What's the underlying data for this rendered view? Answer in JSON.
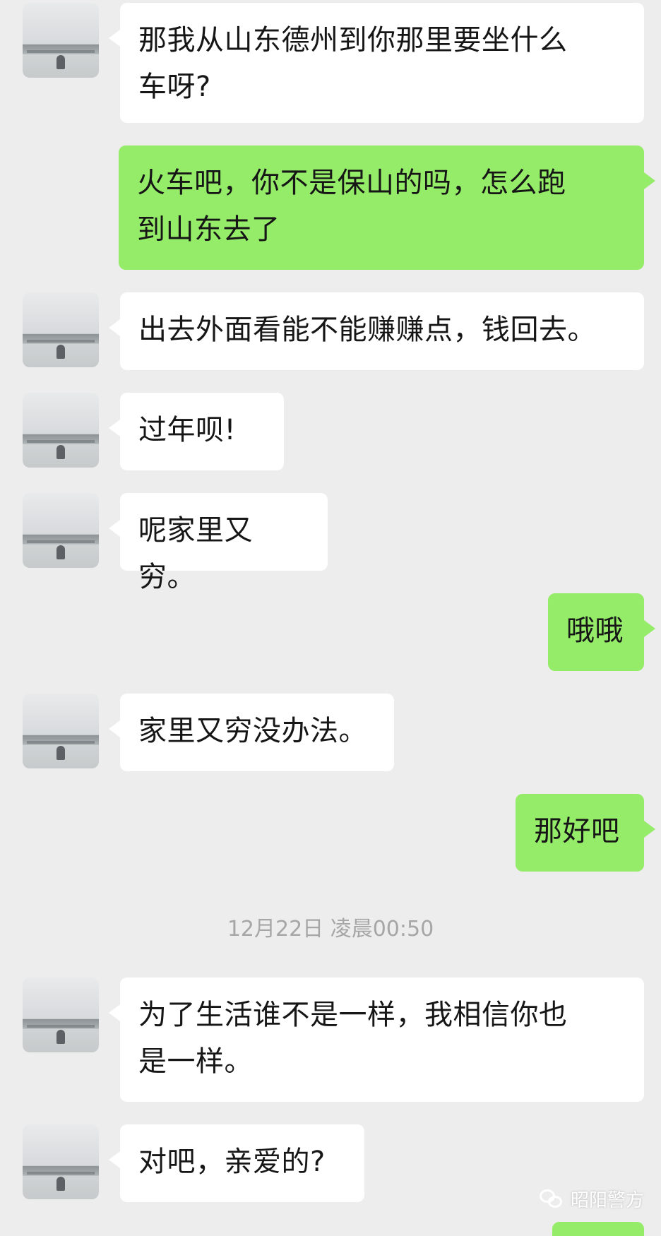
{
  "messages": [
    {
      "from": "contact",
      "text_lines": [
        "那我从山东德州到你那里要坐什么",
        "车呀?"
      ]
    },
    {
      "from": "me",
      "text_lines": [
        "火车吧，你不是保山的吗，怎么跑",
        "到山东去了"
      ]
    },
    {
      "from": "contact",
      "text_lines": [
        "出去外面看能不能赚赚点，钱回去。"
      ]
    },
    {
      "from": "contact",
      "text_lines": [
        "过年呗!"
      ]
    },
    {
      "from": "contact",
      "text_lines": [
        "呢家里又穷。"
      ]
    },
    {
      "from": "me",
      "text_lines": [
        "哦哦"
      ]
    },
    {
      "from": "contact",
      "text_lines": [
        "家里又穷没办法。"
      ]
    },
    {
      "from": "me",
      "text_lines": [
        "那好吧"
      ]
    },
    {
      "from": "contact",
      "text_lines": [
        "为了生活谁不是一样，我相信你也",
        "是一样。"
      ]
    },
    {
      "from": "contact",
      "text_lines": [
        "对吧，亲爱的?"
      ]
    }
  ],
  "timestamp": "12月22日 凌晨00:50",
  "watermark": {
    "text": "昭阳警方",
    "icon": "wechat-icon"
  },
  "colors": {
    "background": "#ededed",
    "incoming_bubble": "#ffffff",
    "outgoing_bubble": "#95ec69",
    "timestamp_text": "#a6a6a6"
  }
}
